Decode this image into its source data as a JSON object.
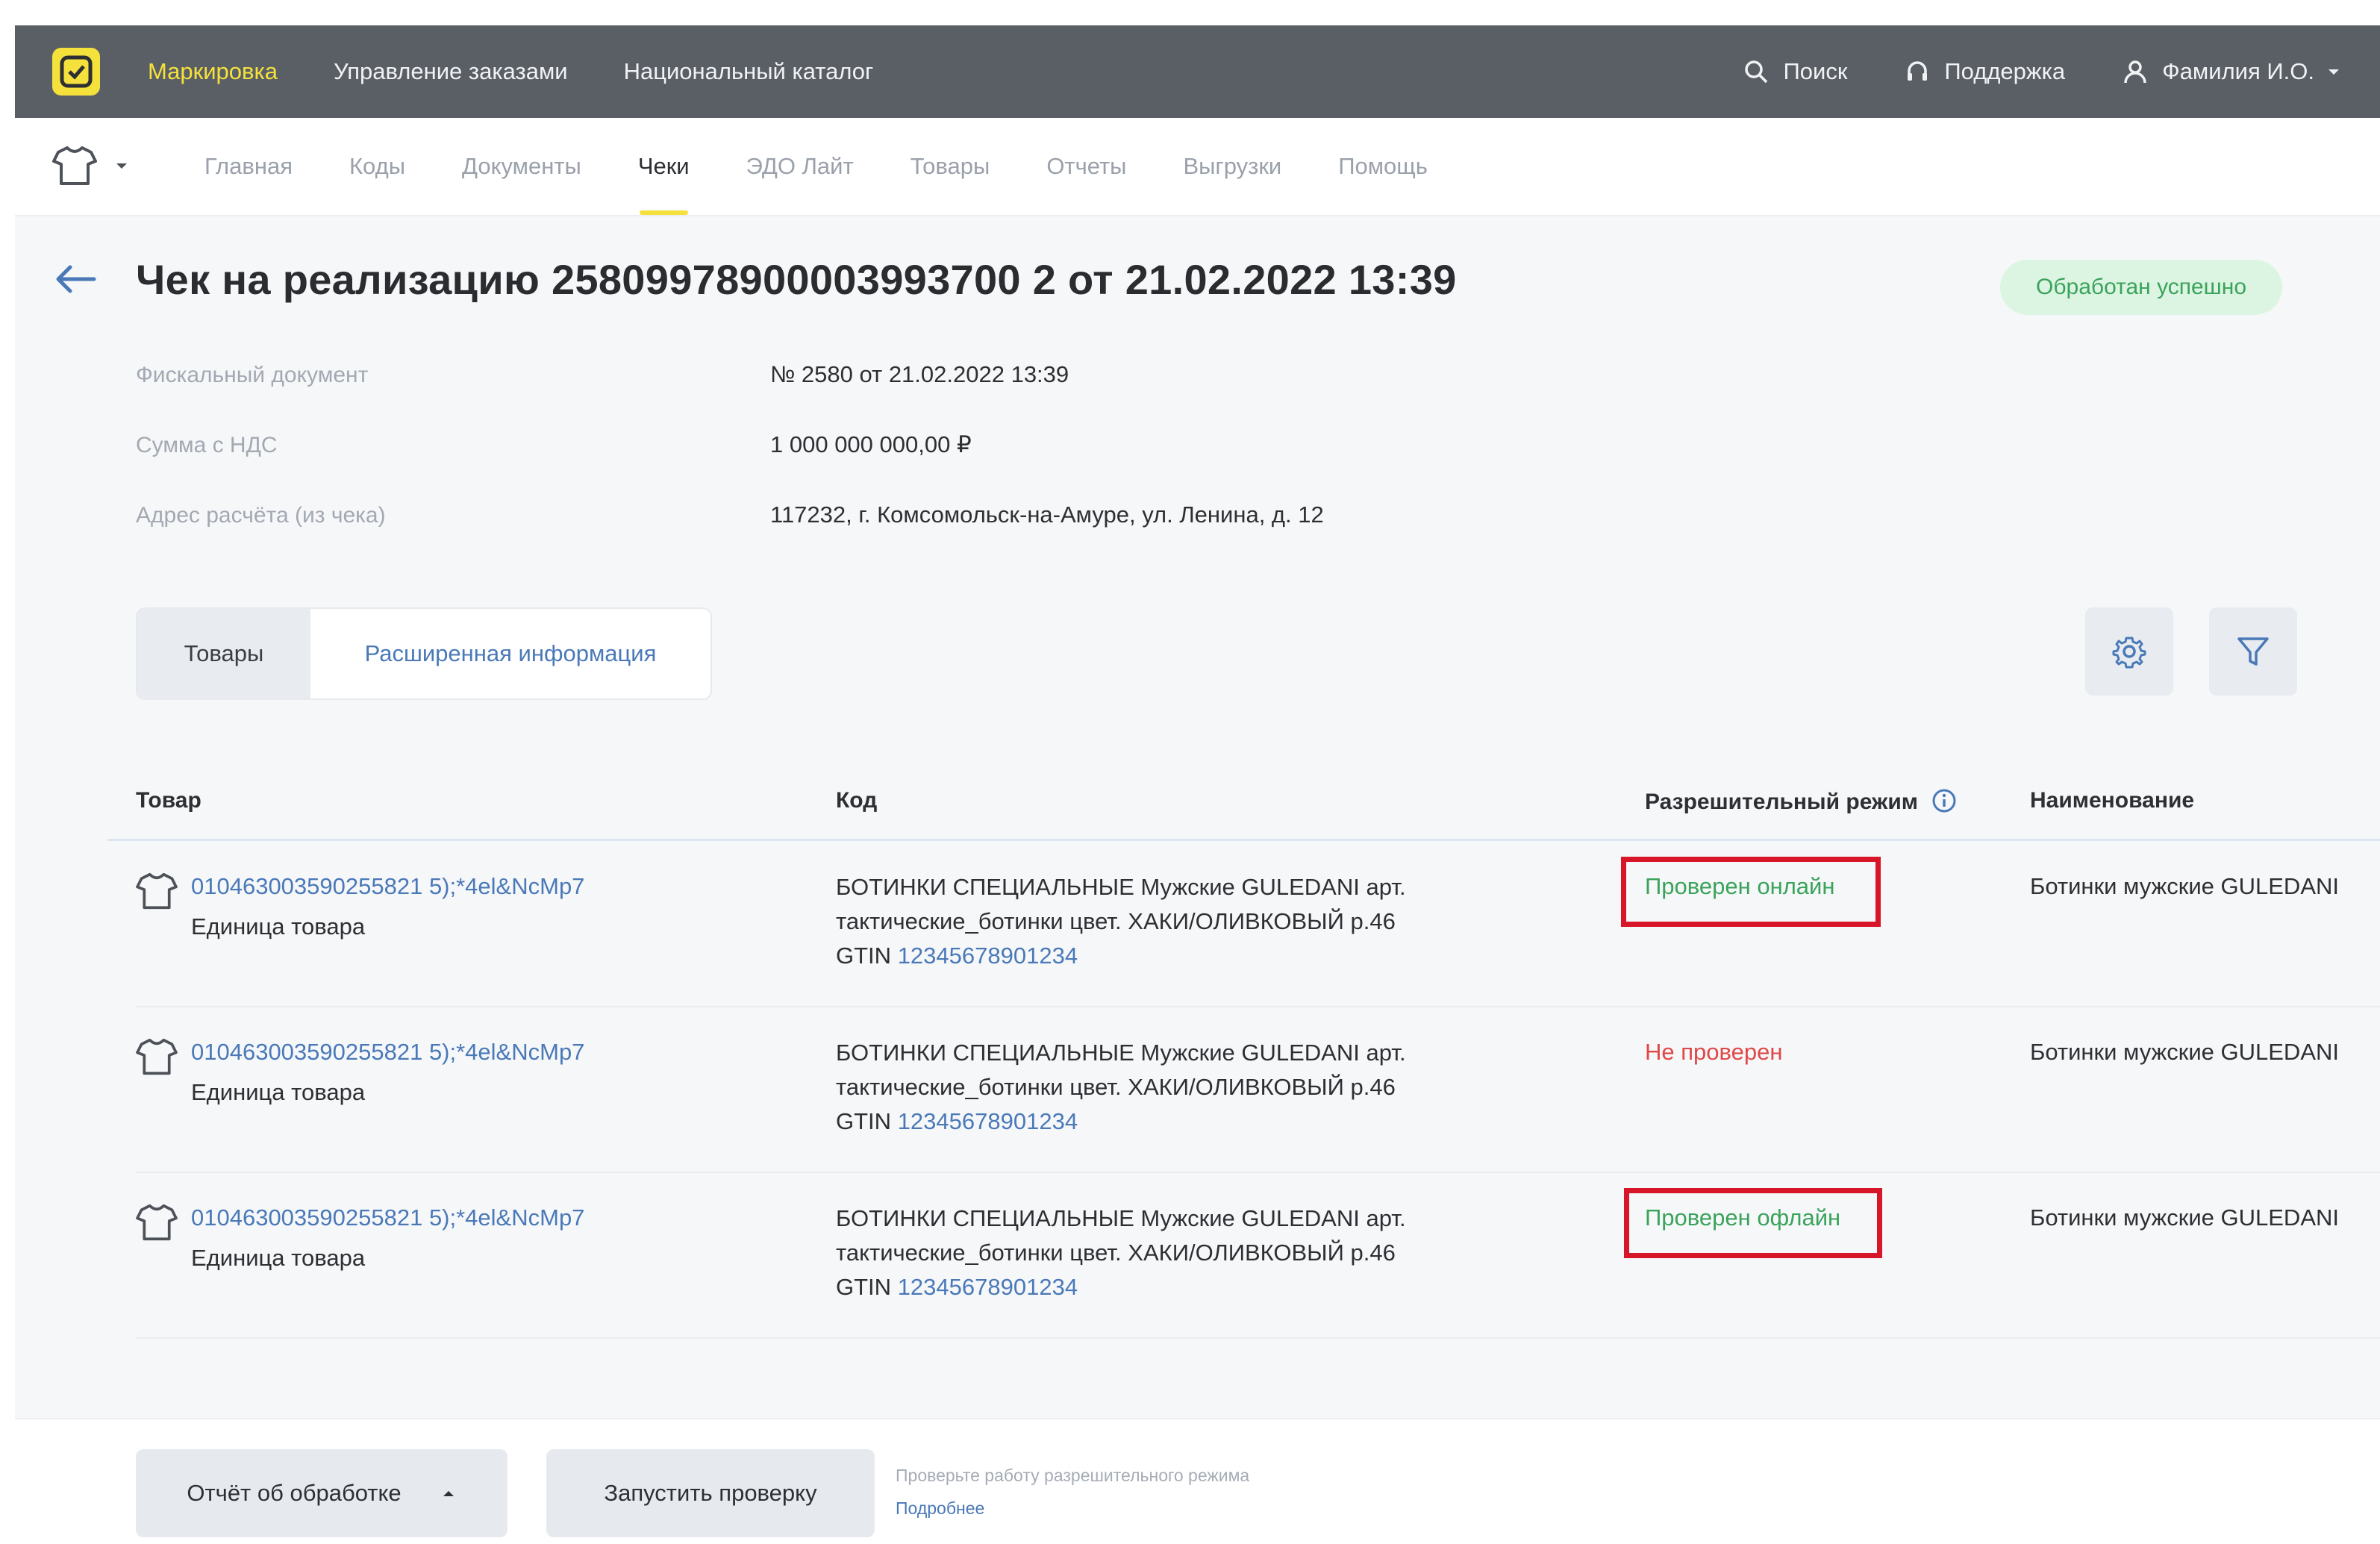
{
  "topbar": {
    "nav": [
      "Маркировка",
      "Управление заказами",
      "Национальный каталог"
    ],
    "search": "Поиск",
    "support": "Поддержка",
    "user": "Фамилия И.О."
  },
  "subnav": {
    "tabs": [
      "Главная",
      "Коды",
      "Документы",
      "Чеки",
      "ЭДО Лайт",
      "Товары",
      "Отчеты",
      "Выгрузки",
      "Помощь"
    ],
    "active_index": 3
  },
  "header": {
    "title": "Чек на реализацию 25809978900003993700 2 от 21.02.2022 13:39",
    "status": "Обработан успешно"
  },
  "info": {
    "fiscal_label": "Фискальный документ",
    "fiscal_value": "№ 2580 от 21.02.2022 13:39",
    "sum_label": "Сумма с НДС",
    "sum_value": "1 000 000 000,00 ₽",
    "address_label": "Адрес расчёта (из чека)",
    "address_value": "117232, г. Комсомольск-на-Амуре, ул. Ленина, д. 12"
  },
  "segments": {
    "goods": "Товары",
    "extended": "Расширенная информация"
  },
  "table": {
    "headers": {
      "product": "Товар",
      "code": "Код",
      "permit": "Разрешительный режим",
      "name": "Наименование"
    },
    "rows": [
      {
        "code": "010463003590255821 5);*4el&NcMp7",
        "unit": "Единица товара",
        "desc1": "БОТИНКИ СПЕЦИАЛЬНЫЕ Мужские GULEDANI арт.",
        "desc2": "тактические_ботинки цвет. ХАКИ/ОЛИВКОВЫЙ р.46",
        "gtin_label": "GTIN",
        "gtin": "12345678901234",
        "permit": "Проверен онлайн",
        "name": "Ботинки мужские GULEDANI"
      },
      {
        "code": "010463003590255821 5);*4el&NcMp7",
        "unit": "Единица товара",
        "desc1": "БОТИНКИ СПЕЦИАЛЬНЫЕ Мужские GULEDANI арт.",
        "desc2": "тактические_ботинки цвет. ХАКИ/ОЛИВКОВЫЙ р.46",
        "gtin_label": "GTIN",
        "gtin": "12345678901234",
        "permit": "Не проверен",
        "name": "Ботинки мужские GULEDANI"
      },
      {
        "code": "010463003590255821 5);*4el&NcMp7",
        "unit": "Единица товара",
        "desc1": "БОТИНКИ СПЕЦИАЛЬНЫЕ Мужские GULEDANI арт.",
        "desc2": "тактические_ботинки цвет. ХАКИ/ОЛИВКОВЫЙ р.46",
        "gtin_label": "GTIN",
        "gtin": "12345678901234",
        "permit": "Проверен офлайн",
        "name": "Ботинки мужские GULEDANI"
      }
    ]
  },
  "bottom": {
    "report": "Отчёт об обработке",
    "run": "Запустить проверку",
    "hint": "Проверьте работу разрешительного режима",
    "hint_link": "Подробнее"
  },
  "colors": {
    "accent": "#f5e13c",
    "topbar": "#5a5f66",
    "ok": "#3aa35a",
    "bad": "#e04848",
    "link": "#4a79b8",
    "highlight": "#d7162a"
  }
}
